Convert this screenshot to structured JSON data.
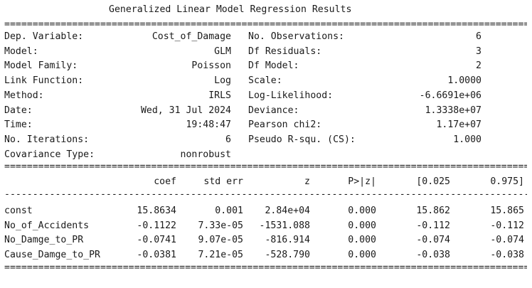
{
  "title": "Generalized Linear Model Regression Results",
  "info": [
    {
      "k1": "Dep. Variable:",
      "v1": "Cost_of_Damage",
      "k2": "No. Observations:",
      "v2": "6"
    },
    {
      "k1": "Model:",
      "v1": "GLM",
      "k2": "Df Residuals:",
      "v2": "3"
    },
    {
      "k1": "Model Family:",
      "v1": "Poisson",
      "k2": "Df Model:",
      "v2": "2"
    },
    {
      "k1": "Link Function:",
      "v1": "Log",
      "k2": "Scale:",
      "v2": "1.0000"
    },
    {
      "k1": "Method:",
      "v1": "IRLS",
      "k2": "Log-Likelihood:",
      "v2": "-6.6691e+06"
    },
    {
      "k1": "Date:",
      "v1": "Wed, 31 Jul 2024",
      "k2": "Deviance:",
      "v2": "1.3338e+07"
    },
    {
      "k1": "Time:",
      "v1": "19:48:47",
      "k2": "Pearson chi2:",
      "v2": "1.17e+07"
    },
    {
      "k1": "No. Iterations:",
      "v1": "6",
      "k2": "Pseudo R-squ. (CS):",
      "v2": "1.000"
    },
    {
      "k1": "Covariance Type:",
      "v1": "nonrobust",
      "k2": "",
      "v2": ""
    }
  ],
  "coef_headers": [
    "coef",
    "std err",
    "z",
    "P>|z|",
    "[0.025",
    "0.975]"
  ],
  "coef_rows": [
    {
      "name": "const",
      "vals": [
        "15.8634",
        "0.001",
        "2.84e+04",
        "0.000",
        "15.862",
        "15.865"
      ]
    },
    {
      "name": "No_of_Accidents",
      "vals": [
        "-0.1122",
        "7.33e-05",
        "-1531.088",
        "0.000",
        "-0.112",
        "-0.112"
      ]
    },
    {
      "name": "No_Damge_to_PR",
      "vals": [
        "-0.0741",
        "9.07e-05",
        "-816.914",
        "0.000",
        "-0.074",
        "-0.074"
      ]
    },
    {
      "name": "Cause_Damge_to_PR",
      "vals": [
        "-0.0381",
        "7.21e-05",
        "-528.790",
        "0.000",
        "-0.038",
        "-0.038"
      ]
    }
  ]
}
